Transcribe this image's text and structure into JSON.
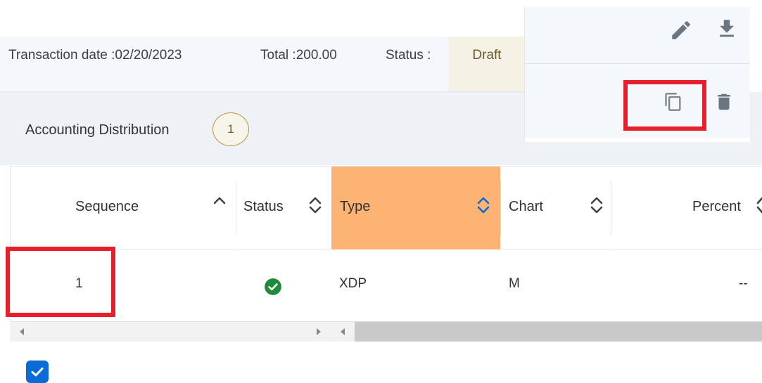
{
  "summary": {
    "transaction_date": "Transaction date :02/20/2023",
    "total": "Total :200.00",
    "status_label": "Status :",
    "status_value": "Draft"
  },
  "section": {
    "title": "Accounting Distribution",
    "count": "1"
  },
  "table": {
    "columns": [
      "Sequence",
      "Status",
      "Type",
      "Chart",
      "Percent"
    ],
    "rows": [
      {
        "sequence": "1",
        "status_icon": "check-circle-icon",
        "type": "XDP",
        "chart": "M",
        "percent": "--"
      }
    ]
  },
  "colors": {
    "accent": "#0a6bd8",
    "highlight": "#e5202b",
    "sorted_column": "#fdb373",
    "status_success": "#1f8a3c",
    "badge_border": "#b39742"
  },
  "icons": [
    "edit-icon",
    "download-icon",
    "copy-icon",
    "delete-icon",
    "sort-asc-icon",
    "sort-icon",
    "check-circle-icon",
    "checkbox-checked-icon",
    "scroll-left-icon",
    "scroll-right-icon"
  ]
}
